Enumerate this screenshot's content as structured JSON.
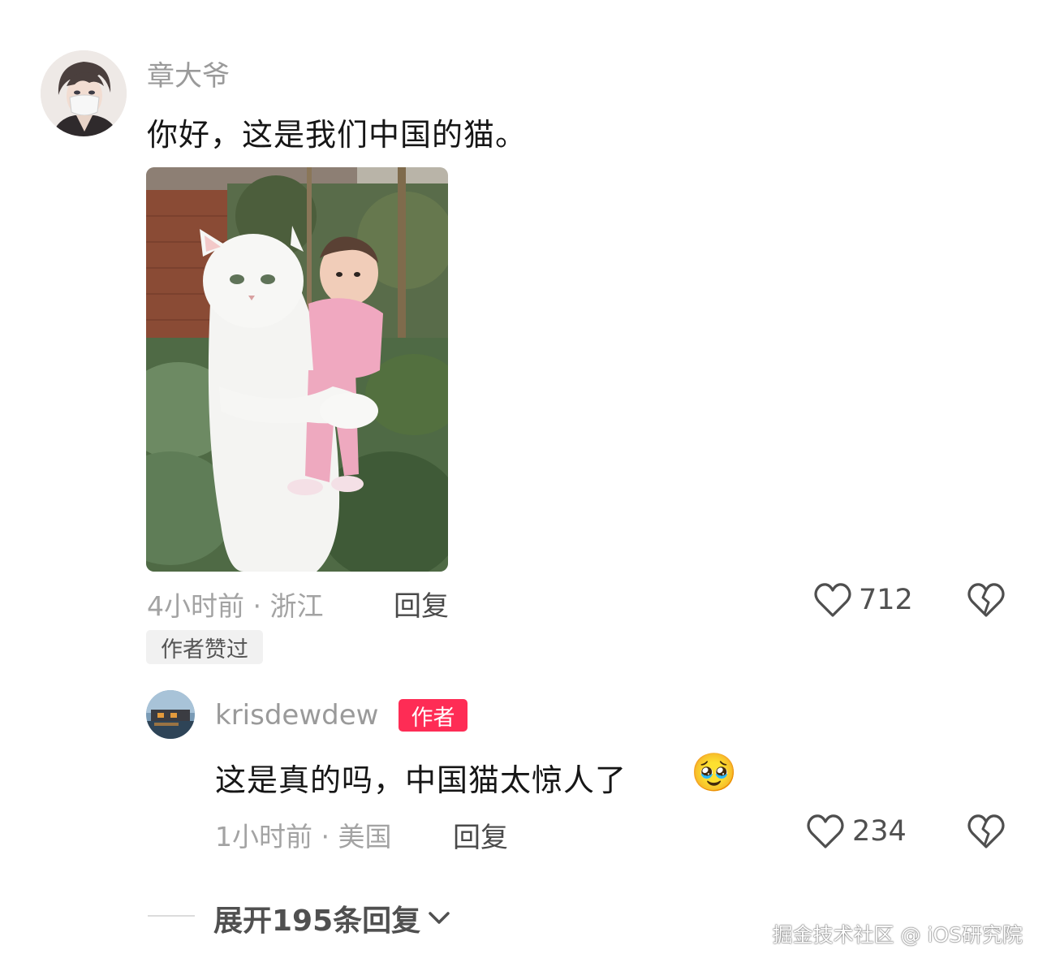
{
  "comment": {
    "username": "章大爷",
    "text": "你好，这是我们中国的猫。",
    "meta": "4小时前 · 浙江",
    "reply_label": "回复",
    "like_count": "712",
    "badge": "作者赞过"
  },
  "reply": {
    "username": "krisdewdew",
    "author_badge": "作者",
    "text": "这是真的吗，中国猫太惊人了",
    "emoji": "🥹",
    "meta": "1小时前 · 美国",
    "reply_label": "回复",
    "like_count": "234"
  },
  "expand": {
    "label": "展开195条回复"
  },
  "watermark": "掘金技术社区 @ iOS研究院",
  "icons": {
    "like": "heart-outline-icon",
    "dislike": "broken-heart-icon",
    "expand": "chevron-down-icon"
  },
  "colors": {
    "author_badge": "#fe2c55",
    "meta_text": "#a3a3a3",
    "username": "#9a9a9a"
  }
}
